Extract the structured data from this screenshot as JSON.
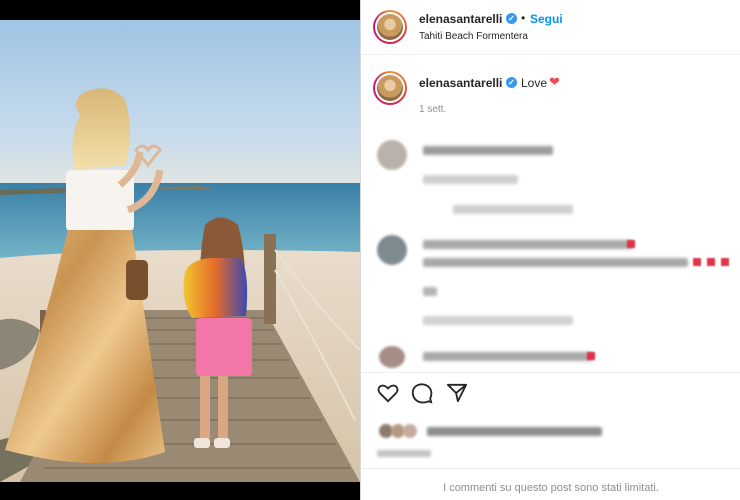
{
  "post": {
    "username": "elenasantarelli",
    "follow_label": "Segui",
    "separator": "•",
    "location": "Tahiti Beach Formentera"
  },
  "caption": {
    "username": "elenasantarelli",
    "text": "Love",
    "heart": "❤",
    "time": "1 sett."
  },
  "footer": {
    "notice": "I commenti su questo post sono stati limitati."
  },
  "icons": [
    "verified-badge-icon",
    "heart-icon",
    "comment-icon",
    "share-icon"
  ],
  "colors": {
    "accent": "#0095f6",
    "heart": "#ed4956",
    "verified": "#3897f0"
  }
}
